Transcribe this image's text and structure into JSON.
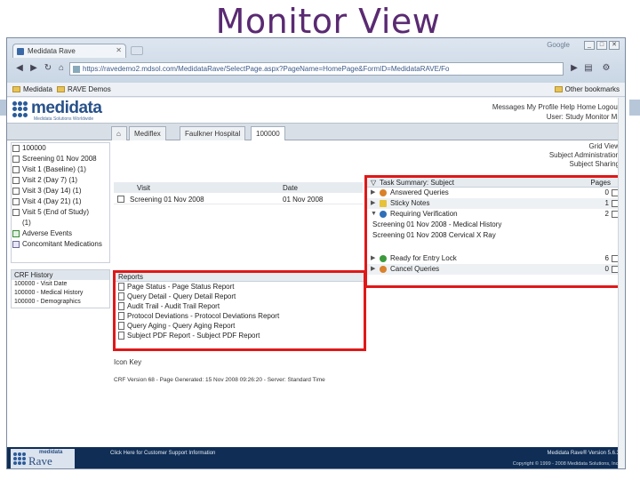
{
  "slide": {
    "title": "Monitor View"
  },
  "browser": {
    "tab_title": "Medidata Rave",
    "google_label": "Google",
    "url": "https://ravedemo2.mdsol.com/MedidataRave/SelectPage.aspx?PageName=HomePage&FormID=MedidataRAVE/Fo",
    "bookmarks": [
      "Medidata",
      "RAVE Demos"
    ],
    "other_bookmarks": "Other bookmarks"
  },
  "header": {
    "logo_word": "medidata",
    "logo_tagline": "Medidata Solutions Worldwide",
    "links": "Messages  My Profile  Help  Home  Logout",
    "user_line": "User: Study Monitor Mr"
  },
  "subtabs": [
    {
      "label": "Home"
    },
    {
      "label": "Mediflex"
    },
    {
      "label": "Faulkner Hospital"
    },
    {
      "label": "100000"
    }
  ],
  "left_nav": {
    "items": [
      {
        "label": "100000",
        "icon": "subject-icon"
      },
      {
        "label": "Screening 01 Nov 2008",
        "icon": "visit-icon"
      },
      {
        "label": "Visit 1 (Baseline) (1)",
        "icon": "visit-icon"
      },
      {
        "label": "Visit 2 (Day 7) (1)",
        "icon": "visit-icon"
      },
      {
        "label": "Visit 3 (Day 14) (1)",
        "icon": "visit-icon"
      },
      {
        "label": "Visit 4 (Day 21) (1)",
        "icon": "visit-icon"
      },
      {
        "label": "Visit 5 (End of Study)",
        "icon": "visit-icon"
      },
      {
        "label": "(1)",
        "icon": ""
      },
      {
        "label": "Adverse Events",
        "icon": "check-icon"
      },
      {
        "label": "Concomitant Medications",
        "icon": "medication-icon"
      }
    ]
  },
  "crf_history": {
    "heading": "CRF History",
    "rows": [
      "100000 - Visit Date",
      "100000 - Medical History",
      "100000 - Demographics"
    ]
  },
  "right_links": [
    "Grid View",
    "Subject Administration",
    "Subject Sharing"
  ],
  "visits": {
    "headers": {
      "visit": "Visit",
      "date": "Date"
    },
    "rows": [
      {
        "visit": "Screening 01 Nov 2008",
        "date": "01 Nov 2008"
      }
    ]
  },
  "task_summary": {
    "title": "Task Summary: Subject",
    "pages_label": "Pages",
    "rows": [
      {
        "label": "Answered Queries",
        "count": "0",
        "color": "#d9822b",
        "expanded": false
      },
      {
        "label": "Sticky Notes",
        "count": "1",
        "color": "#e6c23a",
        "expanded": false
      },
      {
        "label": "Requiring Verification",
        "count": "2",
        "color": "#2f6fb8",
        "expanded": true
      }
    ],
    "sub_rows": [
      "Screening 01 Nov 2008 - Medical History",
      "Screening 01 Nov 2008 Cervical X Ray"
    ],
    "rows2": [
      {
        "label": "Ready for Entry Lock",
        "count": "6",
        "color": "#3c9a3c"
      },
      {
        "label": "Cancel Queries",
        "count": "0",
        "color": "#d9822b"
      }
    ]
  },
  "reports": {
    "heading": "Reports",
    "items": [
      "Page Status - Page Status Report",
      "Query Detail - Query Detail Report",
      "Audit Trail - Audit Trail Report",
      "Protocol Deviations - Protocol Deviations Report",
      "Query Aging - Query Aging Report",
      "Subject PDF Report - Subject PDF Report"
    ]
  },
  "icon_key": "Icon Key",
  "crf_version": "CRF Version 68 - Page Generated: 15 Nov 2008 09:26:20 - Server: Standard Time",
  "footer": {
    "logo_small": "medidata",
    "logo_big": "Rave",
    "help": "Click Here for Customer Support Information",
    "version": "Medidata Rave® Version 5.6.3",
    "copyright": "Copyright © 1999 - 2008 Medidata Solutions, Inc."
  }
}
